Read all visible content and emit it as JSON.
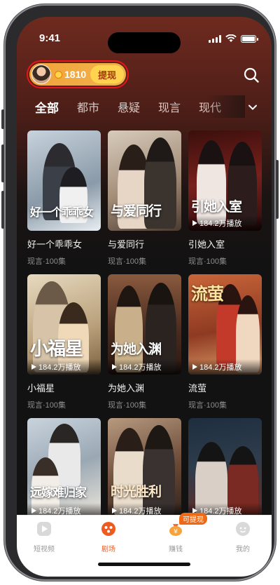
{
  "status": {
    "time": "9:41"
  },
  "header": {
    "coin_count": "1810",
    "withdraw_label": "提现"
  },
  "tabs": [
    "全部",
    "都市",
    "悬疑",
    "现言",
    "现代"
  ],
  "dramas": [
    {
      "title": "好一个乖乖女",
      "meta": "现言·100集",
      "plays": "",
      "art": "好一个乖乖女",
      "palette": [
        "#9fb3c6",
        "#e7eef4"
      ]
    },
    {
      "title": "与爱同行",
      "meta": "现言·100集",
      "plays": "",
      "art": "与爱同行",
      "palette": [
        "#c9b8a6",
        "#5a4438"
      ]
    },
    {
      "title": "引她入室",
      "meta": "现言·100集",
      "plays": "184.2万播放",
      "art": "引她入室",
      "palette": [
        "#5b1d1a",
        "#b03b30"
      ]
    },
    {
      "title": "小福星",
      "meta": "现言·100集",
      "plays": "184.2万播放",
      "art": "小福星",
      "palette": [
        "#d8c7a6",
        "#8a6a45"
      ]
    },
    {
      "title": "为她入渊",
      "meta": "现言·100集",
      "plays": "184.2万播放",
      "art": "为她入渊",
      "palette": [
        "#6b3a2a",
        "#2f1a14"
      ]
    },
    {
      "title": "流萤",
      "meta": "现言·100集",
      "plays": "184.2万播放",
      "art": "流萤",
      "palette": [
        "#a14a2c",
        "#e0a16a"
      ]
    },
    {
      "title": "",
      "meta": "",
      "plays": "184.2万播放",
      "art": "远嫁难归家",
      "palette": [
        "#b8c4cf",
        "#e9e3d8"
      ]
    },
    {
      "title": "",
      "meta": "",
      "plays": "184.2万播放",
      "art": "时光胜利",
      "palette": [
        "#7a5a45",
        "#3a2a24"
      ]
    },
    {
      "title": "",
      "meta": "",
      "plays": "184.2万播放",
      "art": "",
      "palette": [
        "#223244",
        "#5b2a24"
      ]
    }
  ],
  "nav": {
    "items": [
      {
        "label": "短视频"
      },
      {
        "label": "剧场"
      },
      {
        "label": "赚钱"
      },
      {
        "label": "我的"
      }
    ],
    "earn_badge": "可提现"
  },
  "colors": {
    "accent": "#ef5b1e",
    "pill_border": "#e8141a",
    "withdraw_bg": "#ffd24f"
  }
}
